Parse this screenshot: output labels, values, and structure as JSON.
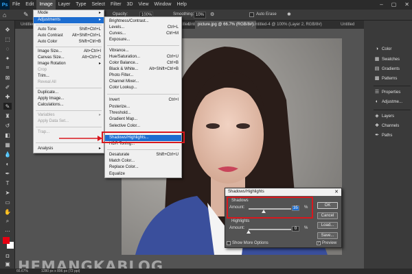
{
  "menubar": {
    "logo": "Ps",
    "items": [
      "File",
      "Edit",
      "Image",
      "Layer",
      "Type",
      "Select",
      "Filter",
      "3D",
      "View",
      "Window",
      "Help"
    ],
    "window_controls": [
      "–",
      "▢",
      "✕"
    ]
  },
  "options_bar": {
    "mode_label": "Mode:",
    "opacity_label": "Opacity:",
    "opacity_value": "100%",
    "smoothing_label": "Smoothing:",
    "smoothing_value": "10%",
    "auto_erase_label": "Auto Erase"
  },
  "tabs": [
    "Untitled-1",
    "Untitled",
    "Untitled",
    "picture.jpg @ 66.7% (RGB/8#)",
    "Untitled-4 @ 100% (Layer 2, RGB/8#)",
    "Untitled"
  ],
  "image_menu": [
    {
      "label": "Mode",
      "arrow": true
    },
    {
      "label": "Adjustments",
      "arrow": true,
      "highlighted": true
    },
    {
      "sep": true
    },
    {
      "label": "Auto Tone",
      "shortcut": "Shift+Ctrl+L"
    },
    {
      "label": "Auto Contrast",
      "shortcut": "Alt+Shift+Ctrl+L"
    },
    {
      "label": "Auto Color",
      "shortcut": "Shift+Ctrl+B"
    },
    {
      "sep": true
    },
    {
      "label": "Image Size...",
      "shortcut": "Alt+Ctrl+I"
    },
    {
      "label": "Canvas Size...",
      "shortcut": "Alt+Ctrl+C"
    },
    {
      "label": "Image Rotation",
      "arrow": true
    },
    {
      "label": "Crop",
      "disabled": true
    },
    {
      "label": "Trim..."
    },
    {
      "label": "Reveal All",
      "disabled": true
    },
    {
      "sep": true
    },
    {
      "label": "Duplicate..."
    },
    {
      "label": "Apply Image..."
    },
    {
      "label": "Calculations..."
    },
    {
      "sep": true
    },
    {
      "label": "Variables",
      "arrow": true,
      "disabled": true
    },
    {
      "label": "Apply Data Set...",
      "disabled": true
    },
    {
      "sep": true
    },
    {
      "label": "Trap...",
      "disabled": true
    },
    {
      "sep": true
    },
    {
      "label": "Analysis",
      "arrow": true
    }
  ],
  "adjustments_menu": [
    {
      "label": "Brightness/Contrast..."
    },
    {
      "label": "Levels...",
      "shortcut": "Ctrl+L"
    },
    {
      "label": "Curves...",
      "shortcut": "Ctrl+M"
    },
    {
      "label": "Exposure..."
    },
    {
      "sep": true
    },
    {
      "label": "Vibrance..."
    },
    {
      "label": "Hue/Saturation...",
      "shortcut": "Ctrl+U"
    },
    {
      "label": "Color Balance...",
      "shortcut": "Ctrl+B"
    },
    {
      "label": "Black & White...",
      "shortcut": "Alt+Shift+Ctrl+B"
    },
    {
      "label": "Photo Filter..."
    },
    {
      "label": "Channel Mixer..."
    },
    {
      "label": "Color Lookup..."
    },
    {
      "sep": true
    },
    {
      "label": "Invert",
      "shortcut": "Ctrl+I"
    },
    {
      "label": "Posterize..."
    },
    {
      "label": "Threshold..."
    },
    {
      "label": "Gradient Map..."
    },
    {
      "label": "Selective Color..."
    },
    {
      "sep": true
    },
    {
      "label": "Shadows/Highlights...",
      "highlighted": true
    },
    {
      "label": "HDR Toning..."
    },
    {
      "sep": true
    },
    {
      "label": "Desaturate",
      "shortcut": "Shift+Ctrl+U"
    },
    {
      "label": "Match Color..."
    },
    {
      "label": "Replace Color..."
    },
    {
      "label": "Equalize"
    }
  ],
  "dialog": {
    "title": "Shadows/Highlights",
    "close": "✕",
    "shadows_label": "Shadows",
    "shadows_amount_label": "Amount:",
    "shadows_amount_value": "35",
    "shadows_amount_fraction": 0.35,
    "highlights_label": "Highlights",
    "highlights_amount_label": "Amount:",
    "highlights_amount_value": "0",
    "highlights_amount_fraction": 0.0,
    "percent": "%",
    "ok": "OK",
    "cancel": "Cancel",
    "load": "Load...",
    "save": "Save...",
    "show_more": "Show More Options",
    "preview": "Preview",
    "preview_checked": true
  },
  "right_panel": {
    "items": [
      {
        "icon": "color-icon",
        "label": "Color"
      },
      {
        "icon": "swatches-icon",
        "label": "Swatches"
      },
      {
        "icon": "gradients-icon",
        "label": "Gradients"
      },
      {
        "icon": "patterns-icon",
        "label": "Patterns"
      },
      {
        "icon": "properties-icon",
        "label": "Properties"
      },
      {
        "icon": "adjustments-icon",
        "label": "Adjustme..."
      },
      {
        "icon": "layers-icon",
        "label": "Layers"
      },
      {
        "icon": "channels-icon",
        "label": "Channels"
      },
      {
        "icon": "paths-icon",
        "label": "Paths"
      }
    ]
  },
  "status": {
    "zoom": "66.67%",
    "doc": "1280 px x 896 px (72 ppi)"
  },
  "watermark": "HEMANGKABLOG",
  "colors": {
    "highlight": "#1c6dd0",
    "callout": "#d9171d",
    "foreground": "#e60012",
    "background": "#ffffff"
  }
}
